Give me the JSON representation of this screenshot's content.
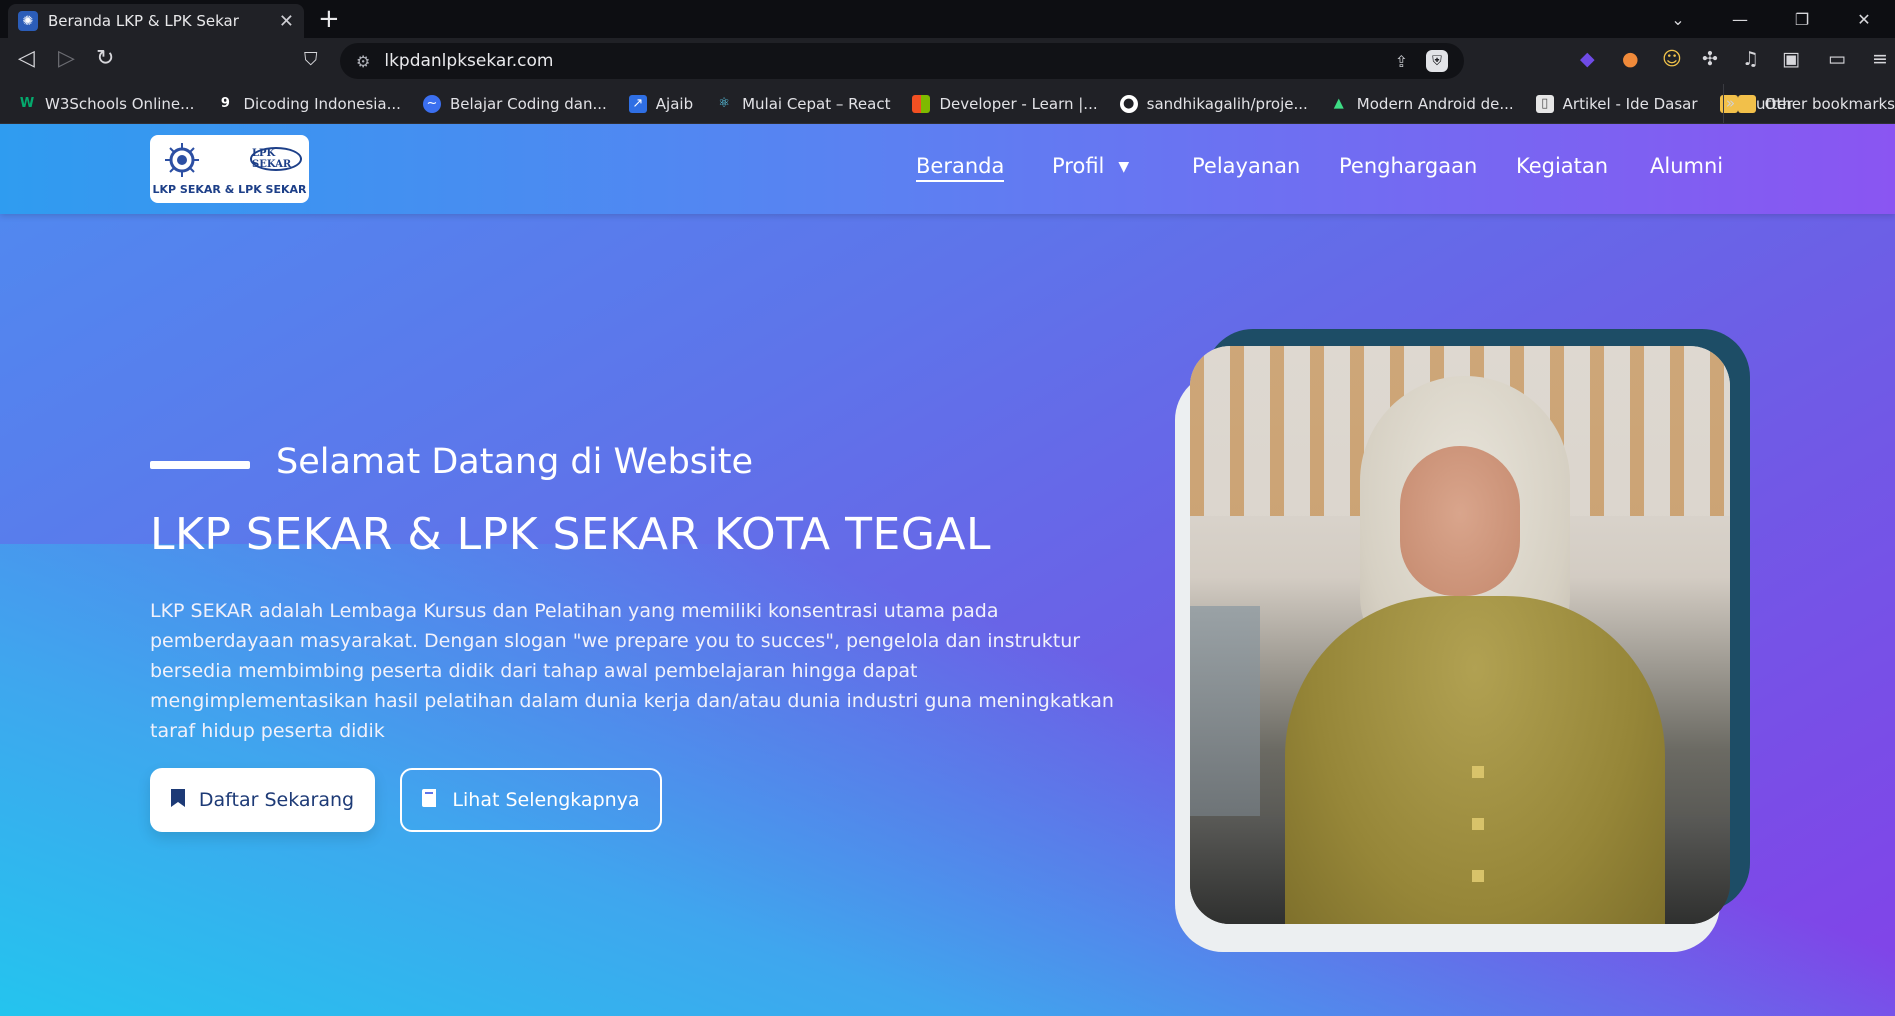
{
  "browser": {
    "tab_title": "Beranda LKP & LPK Sekar",
    "url": "lkpdanlpksekar.com",
    "bookmarks": [
      {
        "label": "W3Schools Online...",
        "icon": "w3schools-icon",
        "color": "#04aa6d"
      },
      {
        "label": "Dicoding Indonesia...",
        "icon": "dicoding-icon",
        "color": "#ffffff"
      },
      {
        "label": "Belajar Coding dan...",
        "icon": "codepolitan-icon",
        "color": "#3b6ff0"
      },
      {
        "label": "Ajaib",
        "icon": "ajaib-icon",
        "color": "#2f6fe4"
      },
      {
        "label": "Mulai Cepat – React",
        "icon": "react-icon",
        "color": "#61dafb"
      },
      {
        "label": "Developer - Learn |...",
        "icon": "microsoft-icon",
        "color": "#f25022"
      },
      {
        "label": "sandhikagalih/proje...",
        "icon": "github-icon",
        "color": "#ffffff"
      },
      {
        "label": "Modern Android de...",
        "icon": "android-icon",
        "color": "#3ddc84"
      },
      {
        "label": "Artikel - Ide Dasar",
        "icon": "article-icon",
        "color": "#e6e6e6"
      },
      {
        "label": "flutter",
        "icon": "folder-icon",
        "color": "#f2c04a"
      }
    ],
    "overflow_label": "»",
    "other_bookmarks": "Other bookmarks"
  },
  "site": {
    "logo_text": "LKP SEKAR & LPK SEKAR",
    "logo_badge": "LPK SEKAR",
    "nav": [
      {
        "label": "Beranda",
        "active": true
      },
      {
        "label": "Profil",
        "active": false
      },
      {
        "label": "Pelayanan",
        "active": false
      },
      {
        "label": "Penghargaan",
        "active": false
      },
      {
        "label": "Kegiatan",
        "active": false
      },
      {
        "label": "Alumni",
        "active": false
      }
    ],
    "hero": {
      "welcome": "Selamat Datang di Website",
      "title": "LKP SEKAR & LPK SEKAR KOTA TEGAL",
      "description": "LKP SEKAR adalah Lembaga Kursus dan Pelatihan yang memiliki konsentrasi utama pada pemberdayaan masyarakat. Dengan slogan \"we prepare you to succes\", pengelola dan instruktur bersedia membimbing peserta didik dari tahap awal pembelajaran hingga dapat mengimplementasikan hasil pelatihan dalam dunia kerja dan/atau dunia industri guna meningkatkan taraf hidup peserta didik",
      "btn_primary": "Daftar Sekarang",
      "btn_secondary": "Lihat Selengkapnya"
    },
    "colors": {
      "gradient_start": "#2f9cf0",
      "gradient_end": "#8a55f2",
      "photo_frame_dark": "#1d4d66",
      "button_text": "#1d3a76"
    }
  }
}
